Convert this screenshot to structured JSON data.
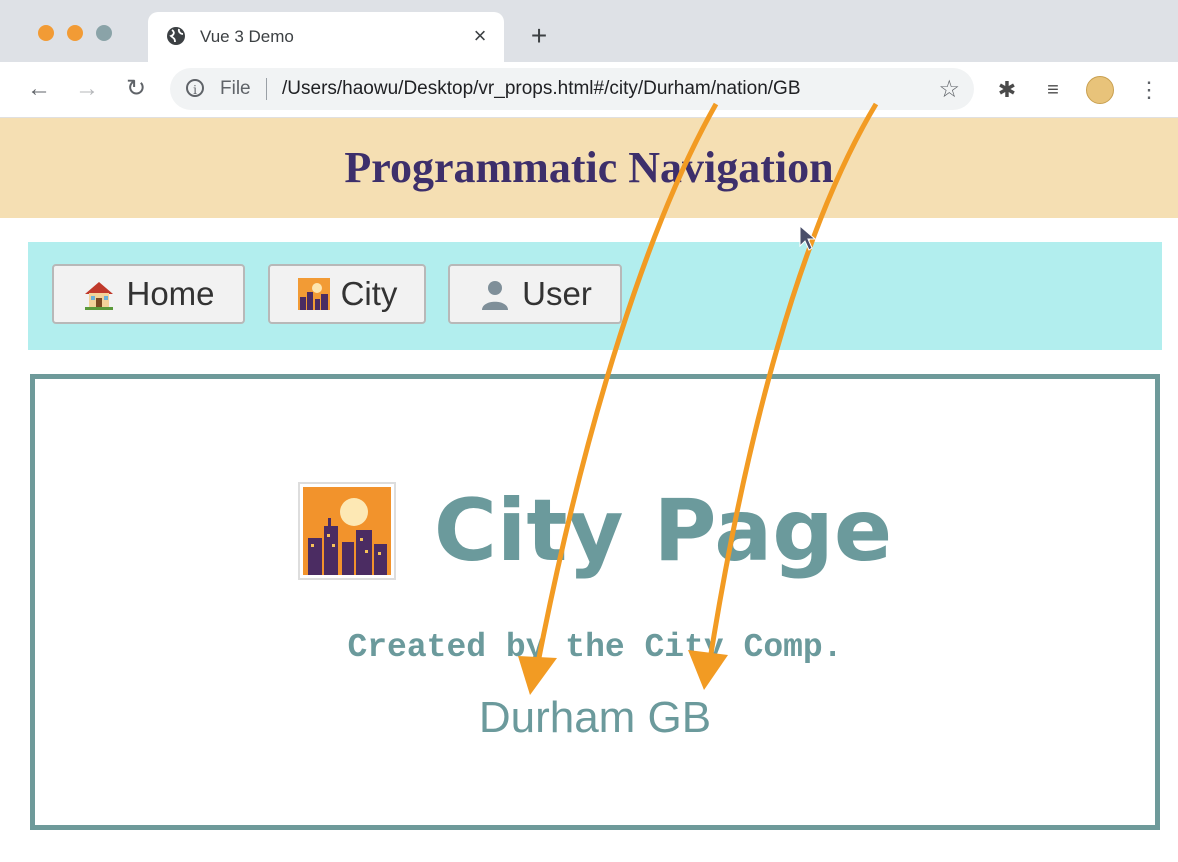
{
  "browser": {
    "tab_title": "Vue 3 Demo",
    "tab_close": "×",
    "new_tab": "+",
    "scheme_label": "File",
    "url": "/Users/haowu/Desktop/vr_props.html#/city/Durham/nation/GB"
  },
  "page": {
    "title": "Programmatic Navigation",
    "nav": {
      "home_label": "Home",
      "city_label": "City",
      "user_label": "User"
    },
    "city": {
      "heading": "City Page",
      "credit": "Created by the City Comp.",
      "params": "Durham GB"
    }
  },
  "colors": {
    "header_band": "#f5dfb3",
    "title": "#3d2f6b",
    "nav_bar": "#b2eeee",
    "content_border": "#6e9a9a",
    "content_text": "#6b9a9c",
    "annotation_arrow": "#f29b23"
  },
  "icons": {
    "home": "house-icon",
    "city": "cityscape-icon",
    "user": "person-icon",
    "tab": "globe-icon",
    "cursor": "mouse-pointer-icon"
  }
}
